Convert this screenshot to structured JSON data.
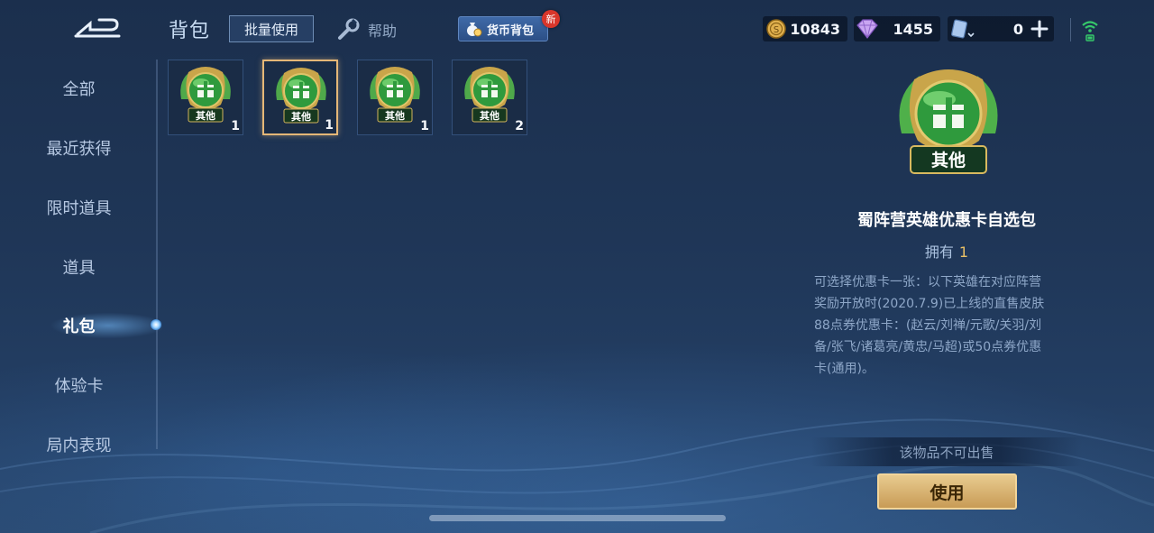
{
  "header": {
    "title": "背包",
    "batch_use_label": "批量使用",
    "help_label": "帮助",
    "currency_bag_label": "货币背包",
    "new_badge": "新"
  },
  "currencies": {
    "gold_coins": "10843",
    "diamonds": "1455",
    "coupons": "0"
  },
  "nav": {
    "items": [
      {
        "label": "全部"
      },
      {
        "label": "最近获得"
      },
      {
        "label": "限时道具"
      },
      {
        "label": "道具"
      },
      {
        "label": "礼包"
      },
      {
        "label": "体验卡"
      },
      {
        "label": "局内表现"
      }
    ],
    "active": "礼包"
  },
  "inventory": {
    "slots": [
      {
        "tag": "其他",
        "count": "1",
        "selected": false
      },
      {
        "tag": "其他",
        "count": "1",
        "selected": true
      },
      {
        "tag": "其他",
        "count": "1",
        "selected": false
      },
      {
        "tag": "其他",
        "count": "2",
        "selected": false
      }
    ]
  },
  "detail": {
    "tag": "其他",
    "name": "蜀阵营英雄优惠卡自选包",
    "own_label": "拥有",
    "own_count": "1",
    "description_lines": [
      "可选择优惠卡一张：以下英雄在对应阵营",
      "奖励开放时(2020.7.9)已上线的直售皮肤",
      "88点券优惠卡：(赵云/刘禅/元歌/关羽/刘",
      "备/张飞/诸葛亮/黄忠/马超)或50点券优惠",
      "卡(通用)。"
    ],
    "not_for_sale": "该物品不可出售",
    "use_label": "使用"
  },
  "colors": {
    "accent_gold": "#e8c066",
    "button_gold": "#d4ad6c",
    "background": "#1f3657"
  }
}
